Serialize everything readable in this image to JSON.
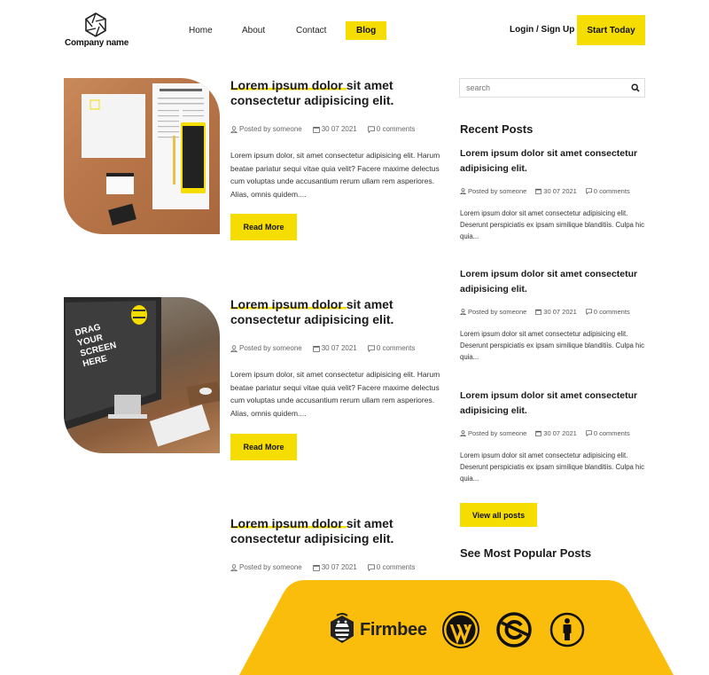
{
  "header": {
    "company_name": "Company name",
    "nav": [
      {
        "label": "Home",
        "active": false
      },
      {
        "label": "About",
        "active": false
      },
      {
        "label": "Contact",
        "active": false
      },
      {
        "label": "Blog",
        "active": true
      }
    ],
    "login_label": "Login / Sign Up",
    "cta_label": "Start Today"
  },
  "colors": {
    "accent": "#f5dd00",
    "banner": "#fbbd0c",
    "text": "#1b1b1b"
  },
  "posts": [
    {
      "title_highlight": "Lorem ipsum dolor ",
      "title_rest": "sit amet consectetur adipisicing elit.",
      "author": "Posted by someone",
      "date": "30 07 2021",
      "comments": "0 comments",
      "excerpt": "Lorem ipsum dolor, sit amet consectetur adipisicing elit. Harum beatae pariatur sequi vitae quia velit? Facere maxime delectus cum voluptas unde accusantium rerum ullam rem asperiores. Alias, omnis quidem....",
      "button": "Read More",
      "image_alt": "Firmbee stationery mockup"
    },
    {
      "title_highlight": "Lorem ipsum dolor ",
      "title_rest": "sit amet consectetur adipisicing elit.",
      "author": "Posted by someone",
      "date": "30 07 2021",
      "comments": "0 comments",
      "excerpt": "Lorem ipsum dolor, sit amet consectetur adipisicing elit. Harum beatae pariatur sequi vitae quia velit? Facere maxime delectus cum voluptas unde accusantium rerum ullam rem asperiores. Alias, omnis quidem....",
      "button": "Read More",
      "image_alt": "Firmbee desktop mockup",
      "image_screen_text": "DRAG YOUR SCREEN HERE"
    },
    {
      "title_highlight": "Lorem ipsum dolor ",
      "title_rest": "sit amet consectetur adipisicing elit.",
      "author": "Posted by someone",
      "date": "30 07 2021",
      "comments": "0 comments"
    }
  ],
  "sidebar": {
    "search_placeholder": "search",
    "recent_heading": "Recent Posts",
    "recent_posts": [
      {
        "title": "Lorem ipsum dolor sit amet consectetur adipisicing elit.",
        "author": "Posted by someone",
        "date": "30 07 2021",
        "comments": "0 comments",
        "excerpt": "Lorem ipsum dolor sit amet consectetur adipisicing elit. Deserunt perspiciatis ex ipsam similique blanditiis. Culpa hic quia..."
      },
      {
        "title": "Lorem ipsum dolor sit amet consectetur adipisicing elit.",
        "author": "Posted by someone",
        "date": "30 07 2021",
        "comments": "0 comments",
        "excerpt": "Lorem ipsum dolor sit amet consectetur adipisicing elit. Deserunt perspiciatis ex ipsam similique blanditiis. Culpa hic quia..."
      },
      {
        "title": "Lorem ipsum dolor sit amet consectetur adipisicing elit.",
        "author": "Posted by someone",
        "date": "30 07 2021",
        "comments": "0 comments",
        "excerpt": "Lorem ipsum dolor sit amet consectetur adipisicing elit. Deserunt perspiciatis ex ipsam similique blanditiis. Culpa hic quia..."
      }
    ],
    "view_all_label": "View all posts",
    "popular_heading": "See Most Popular Posts"
  },
  "banner": {
    "brand": "Firmbee",
    "icons": [
      "firmbee-bee-icon",
      "wordpress-icon",
      "noncommercial-icon",
      "attribution-icon"
    ]
  }
}
